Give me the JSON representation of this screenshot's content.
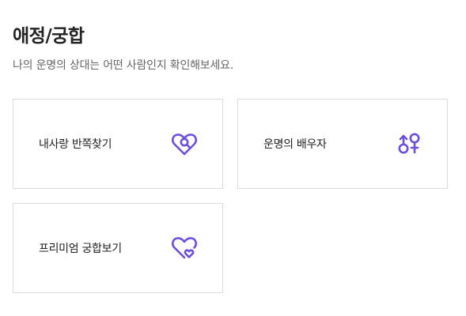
{
  "section": {
    "title": "애정/궁합",
    "subtitle": "나의 운명의 상대는 어떤 사람인지 확인해보세요."
  },
  "cards": [
    {
      "label": "내사랑 반쪽찾기",
      "icon": "heart-search-icon"
    },
    {
      "label": "운명의 배우자",
      "icon": "gender-symbols-icon"
    },
    {
      "label": "프리미엄 궁합보기",
      "icon": "double-heart-icon"
    }
  ],
  "colors": {
    "accent": "#6c4fe0",
    "text": "#222222",
    "subtext": "#666666",
    "border": "#dcdcdc"
  }
}
